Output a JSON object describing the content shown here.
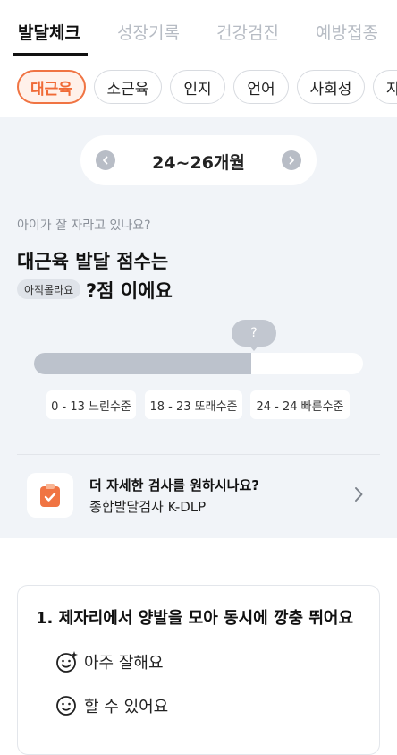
{
  "tabs": [
    {
      "label": "발달체크",
      "active": true
    },
    {
      "label": "성장기록",
      "active": false
    },
    {
      "label": "건강검진",
      "active": false
    },
    {
      "label": "예방접종",
      "active": false
    }
  ],
  "chips": [
    {
      "label": "대근육",
      "active": true
    },
    {
      "label": "소근육",
      "active": false
    },
    {
      "label": "인지",
      "active": false
    },
    {
      "label": "언어",
      "active": false
    },
    {
      "label": "사회성",
      "active": false
    },
    {
      "label": "자",
      "active": false
    }
  ],
  "age": {
    "label": "24~26개월",
    "prev_icon": "chevron-left-icon",
    "next_icon": "chevron-right-icon"
  },
  "score": {
    "question": "아이가 잘 자라고 있나요?",
    "headline_line1": "대근육 발달 점수는",
    "badge": "아직몰라요",
    "headline_line2": "?점 이에요",
    "marker": "?",
    "fill_fraction": 0.66
  },
  "ranges": [
    "0 - 13 느린수준",
    "18 - 23 또래수준",
    "24 - 24 빠른수준"
  ],
  "kdlp": {
    "title": "더 자세한 검사를 원하시나요?",
    "subtitle": "종합발달검사 K-DLP",
    "icon": "clipboard-check-icon"
  },
  "question_card": {
    "title": "1.  제자리에서 양발을 모아 동시에 깡충 뛰어요",
    "options": [
      {
        "label": "아주 잘해요",
        "icon": "sparkle-smile-icon"
      },
      {
        "label": "할 수 있어요",
        "icon": "smile-icon"
      }
    ]
  },
  "colors": {
    "accent": "#f06a36",
    "accent_bg": "#fff1ea",
    "panel_bg": "#f1f4f8",
    "bar_fill": "#bcc2cc"
  }
}
